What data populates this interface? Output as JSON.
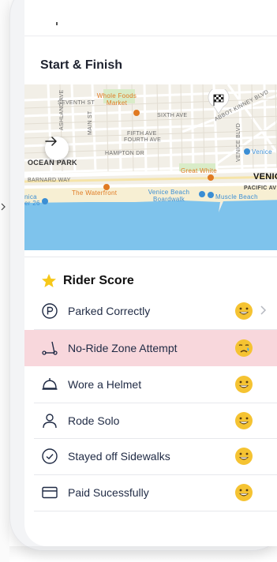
{
  "ride": {
    "start_finish_title": "Start & Finish"
  },
  "map": {
    "streets": [
      "SEVENTH ST",
      "SIXTH AVE",
      "FIFTH AVE",
      "FOURTH AVE",
      "HAMPTON DR",
      "ASHLAND AVE",
      "MAIN ST",
      "ABBOT KINNEY BLVD",
      "VENICE BLVD",
      "PACIFIC AV",
      "BARNARD WAY"
    ],
    "places": [
      "Whole Foods Market",
      "Great White",
      "The Waterfront",
      "Venice Beach Boardwalk",
      "Muscle Beach",
      "Venice",
      "VENIC",
      "OCEAN PARK"
    ],
    "edge_labels": [
      "nica",
      "er 26"
    ],
    "colors": {
      "water": "#7ec3ec",
      "sand": "#f7efd3",
      "land": "#f2efe7",
      "park": "#d9ecc8",
      "poi": "#e07a22",
      "poi_blue": "#3b8ed4"
    }
  },
  "rider_score": {
    "title": "Rider Score",
    "items": [
      {
        "label": "Parked Correctly",
        "icon": "parking-icon",
        "result": "happy-emoji",
        "has_chevron": true
      },
      {
        "label": "No-Ride Zone Attempt",
        "icon": "scooter-icon",
        "result": "crying-emoji",
        "alert": true
      },
      {
        "label": "Wore a Helmet",
        "icon": "helmet-icon",
        "result": "happy-emoji"
      },
      {
        "label": "Rode Solo",
        "icon": "person-icon",
        "result": "happy-emoji"
      },
      {
        "label": "Stayed off Sidewalks",
        "icon": "check-circle-icon",
        "result": "happy-emoji"
      },
      {
        "label": "Paid Sucessfully",
        "icon": "card-icon",
        "result": "happy-emoji"
      }
    ],
    "colors": {
      "alert_bg": "#f8d7dc",
      "star": "#f6c81a",
      "text": "#1f2a44"
    }
  }
}
